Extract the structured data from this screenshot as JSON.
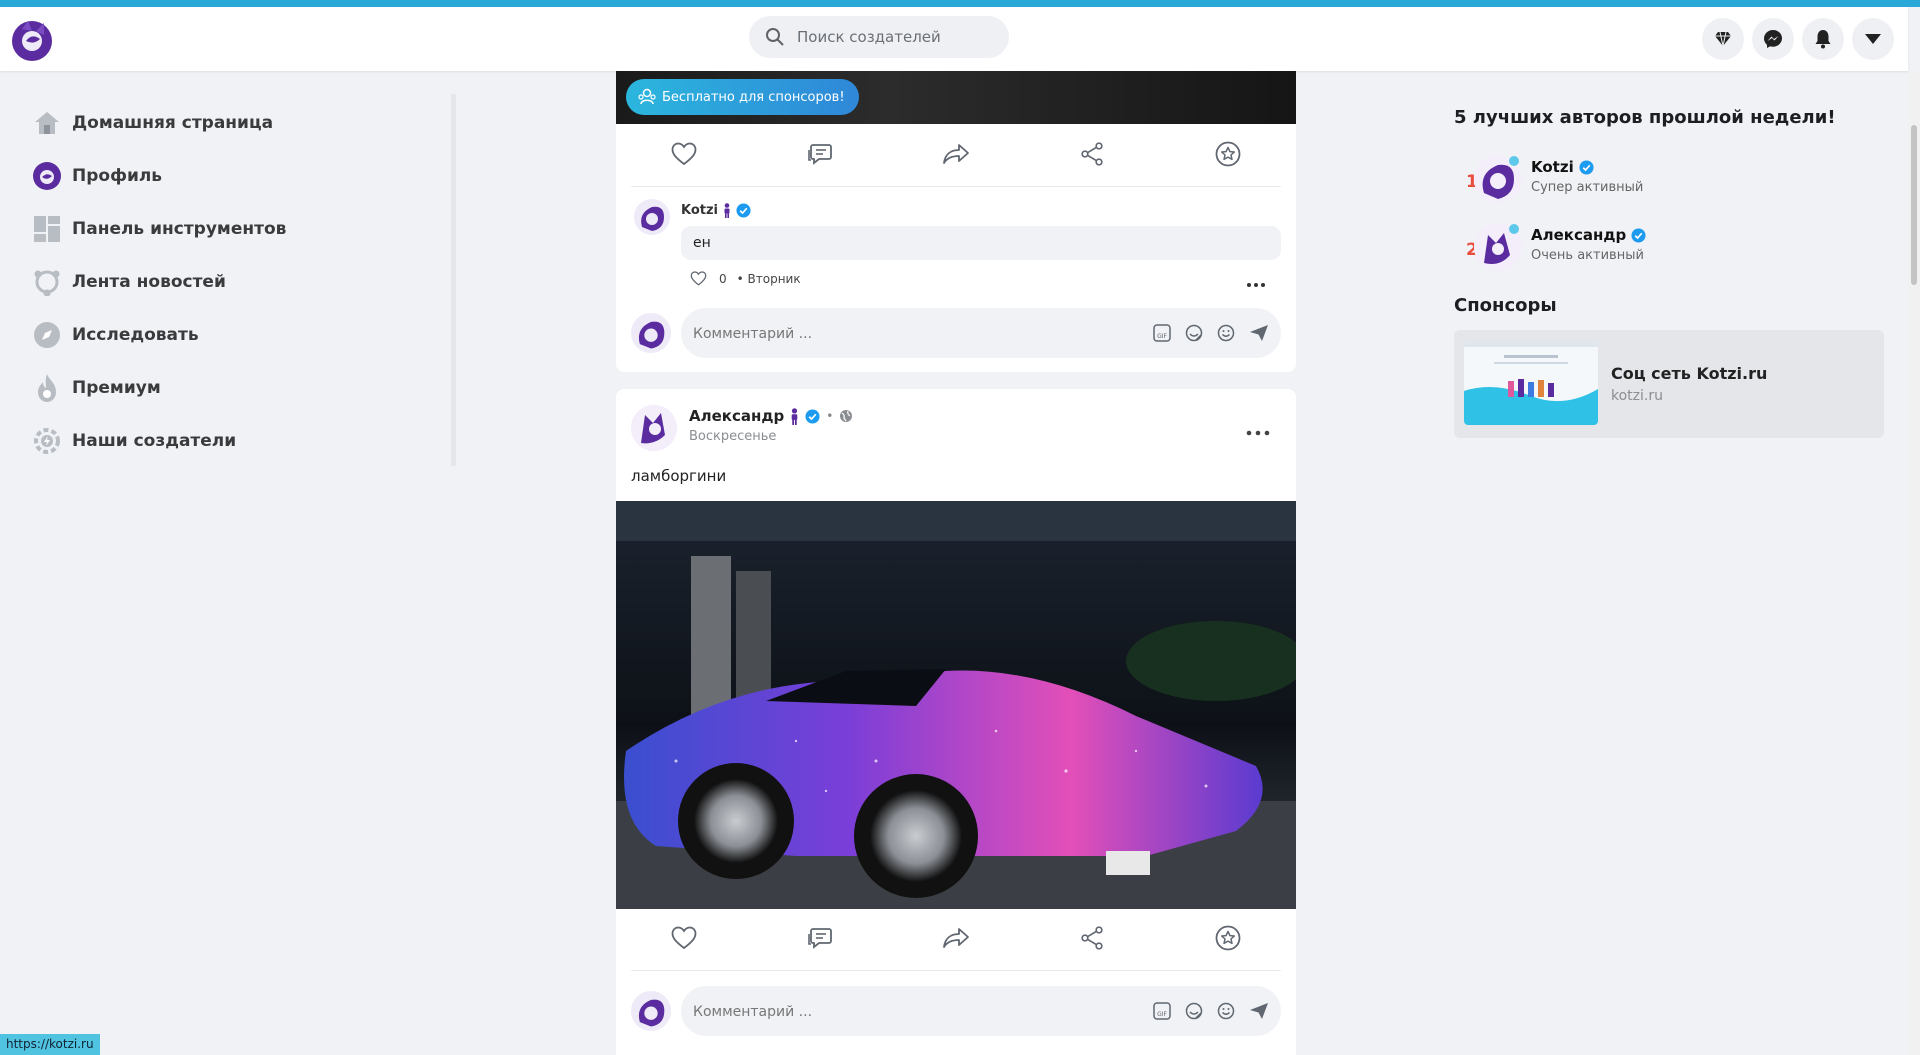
{
  "header": {
    "search_placeholder": "Поиск создателей",
    "icons": [
      "diamond-icon",
      "messenger-icon",
      "bell-icon",
      "caret-down-icon"
    ]
  },
  "sidebar": {
    "items": [
      {
        "label": "Домашняя страница",
        "icon": "home-icon"
      },
      {
        "label": "Профиль",
        "icon": "profile-avatar-icon"
      },
      {
        "label": "Панель инструментов",
        "icon": "dashboard-icon"
      },
      {
        "label": "Лента новостей",
        "icon": "newsfeed-icon"
      },
      {
        "label": "Исследовать",
        "icon": "compass-icon"
      },
      {
        "label": "Премиум",
        "icon": "flame-icon"
      },
      {
        "label": "Наши создатели",
        "icon": "creators-gear-icon"
      }
    ]
  },
  "post1": {
    "sponsor_badge": "Бесплатно для спонсоров!",
    "comment": {
      "author": "Kotzi",
      "text": "ен",
      "likes": "0",
      "time": "• Вторник"
    },
    "composer_placeholder": "Комментарий ..."
  },
  "post2": {
    "author": "Александр",
    "time": "Воскресенье",
    "text": "ламборгини",
    "image_desc_icon": "car-photo",
    "composer_placeholder": "Комментарий ..."
  },
  "right": {
    "top_title": "5 лучших авторов прошлой недели!",
    "authors": [
      {
        "rank": "1",
        "name": "Kotzi",
        "status": "Супер активный"
      },
      {
        "rank": "2",
        "name": "Александр",
        "status": "Очень активный"
      }
    ],
    "sponsors_title": "Спонсоры",
    "sponsor": {
      "name": "Соц сеть Kotzi.ru",
      "url": "kotzi.ru"
    }
  },
  "status_bar": {
    "url": "https://kotzi.ru"
  },
  "colors": {
    "accent": "#2aa8d8",
    "brand_purple": "#5b2c9f",
    "verified": "#1d9bf0",
    "rank_red": "#e74c3c"
  }
}
